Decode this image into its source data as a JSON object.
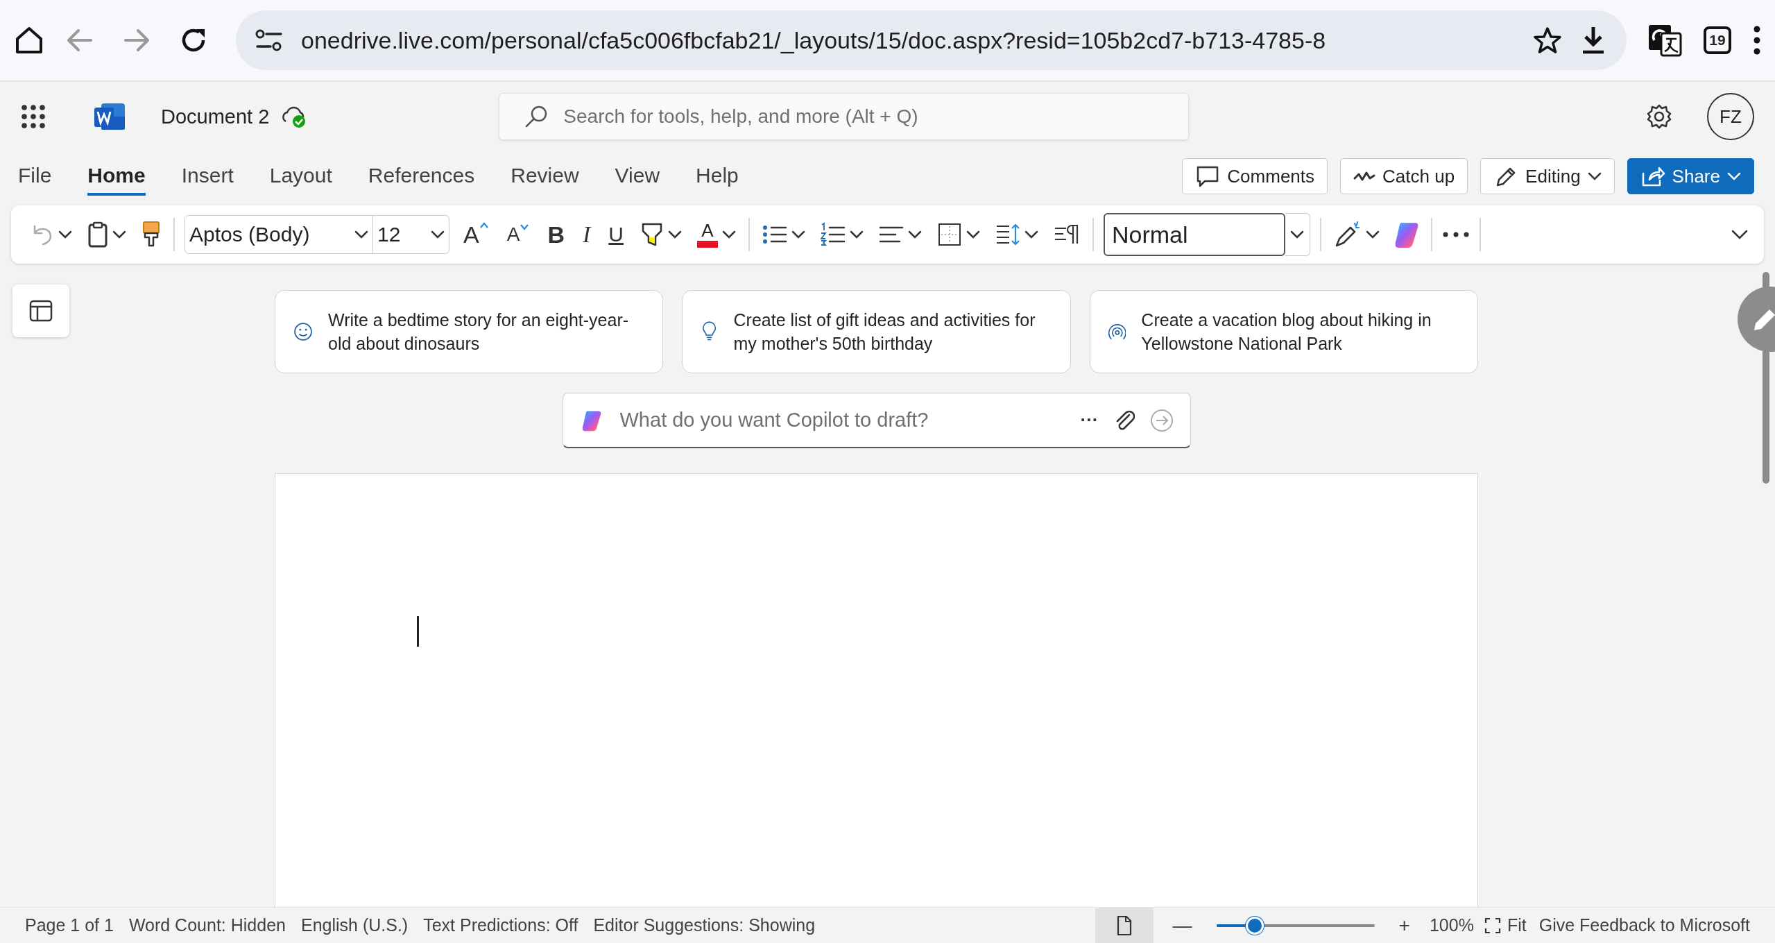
{
  "browser": {
    "url": "onedrive.live.com/personal/cfa5c006fbcfab21/_layouts/15/doc.aspx?resid=105b2cd7-b713-4785-8",
    "tab_count": "19"
  },
  "app": {
    "document_title": "Document 2",
    "search": {
      "placeholder": "Search for tools, help, and more (Alt + Q)"
    },
    "avatar": "FZ"
  },
  "tabs": [
    {
      "label": "File",
      "selected": false
    },
    {
      "label": "Home",
      "selected": true
    },
    {
      "label": "Insert",
      "selected": false
    },
    {
      "label": "Layout",
      "selected": false
    },
    {
      "label": "References",
      "selected": false
    },
    {
      "label": "Review",
      "selected": false
    },
    {
      "label": "View",
      "selected": false
    },
    {
      "label": "Help",
      "selected": false
    }
  ],
  "actions": [
    {
      "kind": "comments",
      "label": "Comments"
    },
    {
      "kind": "catchup",
      "label": "Catch up"
    },
    {
      "kind": "editing",
      "label": "Editing"
    },
    {
      "kind": "share",
      "label": "Share"
    }
  ],
  "ribbon": {
    "undo": {
      "disabled": true
    },
    "font": "Aptos (Body)",
    "size": "12",
    "format": [
      {
        "kind": "grow",
        "glyph": "A"
      },
      {
        "kind": "shrink",
        "glyph": "A"
      },
      {
        "kind": "bold",
        "glyph": "B"
      },
      {
        "kind": "italic",
        "glyph": "I"
      },
      {
        "kind": "underline",
        "glyph": "U"
      }
    ],
    "font_color": {
      "glyph": "A",
      "color": "#e81123"
    },
    "style": "Normal"
  },
  "suggestions": [
    {
      "kind": "smile",
      "text": "Write a bedtime story for an eight-year-old about dinosaurs"
    },
    {
      "kind": "bulb",
      "text": "Create list of gift ideas and activities for my mother's 50th birthday"
    },
    {
      "kind": "signal",
      "text": "Create a vacation blog about hiking in Yellowstone National Park"
    }
  ],
  "copilot": {
    "placeholder": "What do you want Copilot to draft?",
    "more": "···"
  },
  "status_bar": {
    "items": [
      "Page 1 of 1",
      "Word Count: Hidden",
      "English (U.S.)",
      "Text Predictions: Off",
      "Editor Suggestions: Showing"
    ],
    "zoom": {
      "minus": "—",
      "plus": "+",
      "level": 0.22,
      "reading": "100%"
    },
    "fit": "Fit",
    "feedback": "Give Feedback to Microsoft"
  }
}
